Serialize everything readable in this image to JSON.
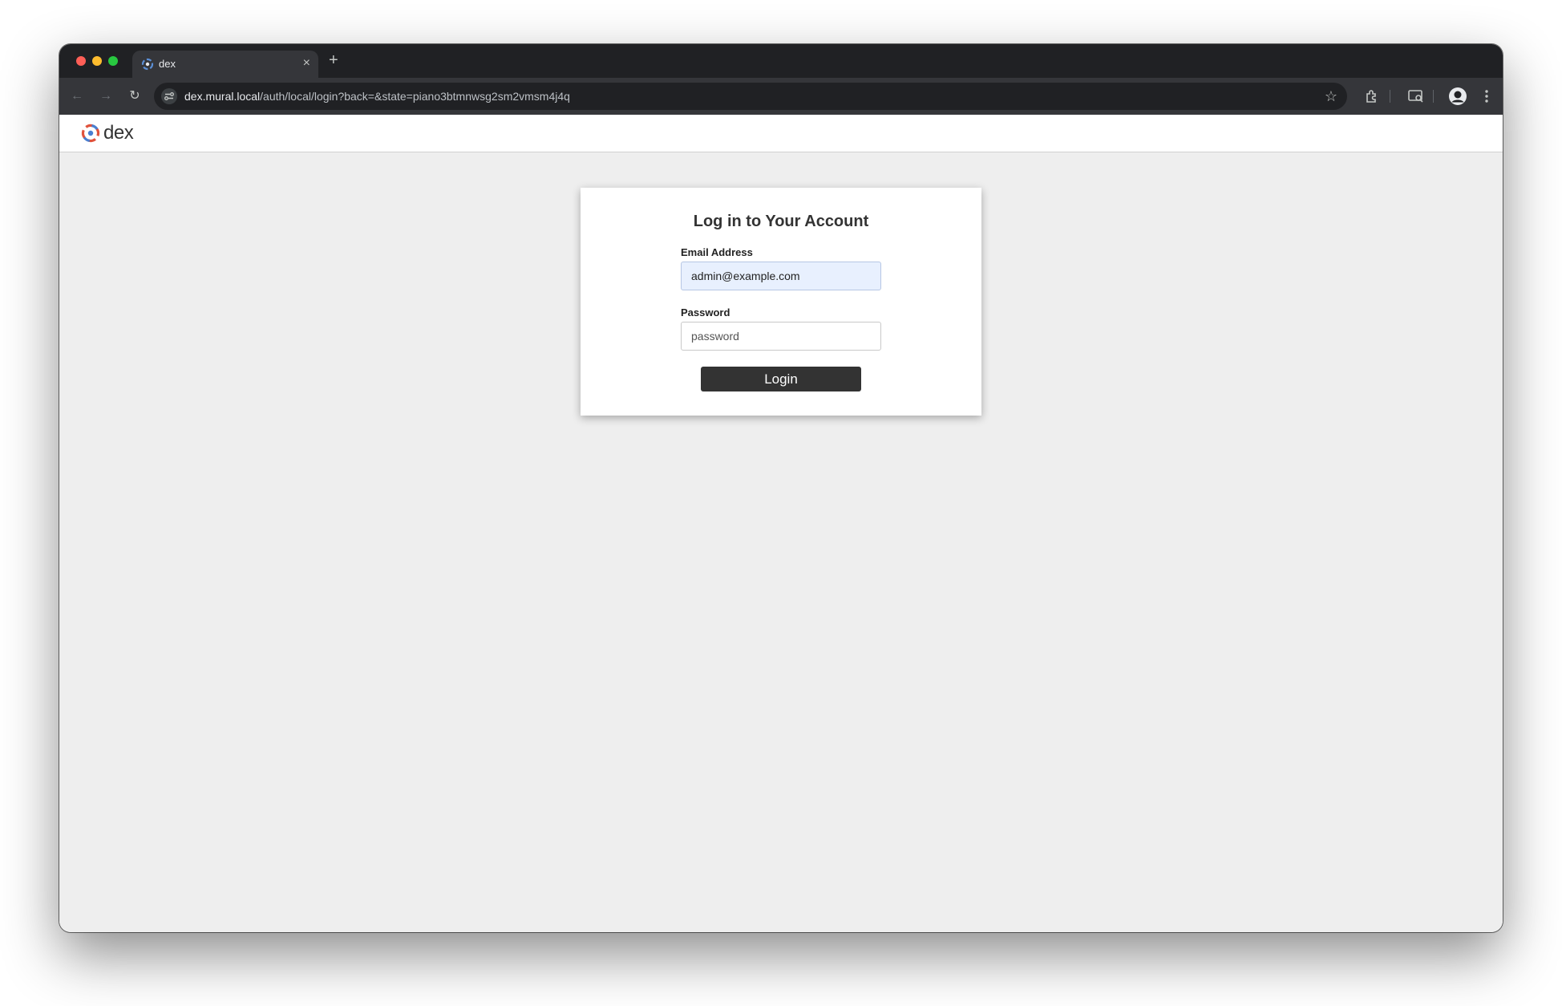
{
  "browser": {
    "tab": {
      "title": "dex",
      "close_icon": "close-icon"
    },
    "new_tab_icon": "plus-icon",
    "address_bar": {
      "host": "dex.mural.local",
      "path": "/auth/local/login?back=&state=piano3btmnwsg2sm2vmsm4j4q"
    },
    "colors": {
      "tab_strip": "#202124",
      "toolbar": "#35363a",
      "close": "#ff5f57",
      "minimize": "#febc2e",
      "maximize": "#28c840"
    }
  },
  "header": {
    "logo_text": "dex"
  },
  "login": {
    "title": "Log in to Your Account",
    "email_label": "Email Address",
    "email_value": "admin@example.com",
    "password_label": "Password",
    "password_placeholder": "password",
    "submit_label": "Login"
  },
  "colors": {
    "page_background": "#eeeeee",
    "button_background": "#333333",
    "autofill_background": "#e8f0fe"
  }
}
